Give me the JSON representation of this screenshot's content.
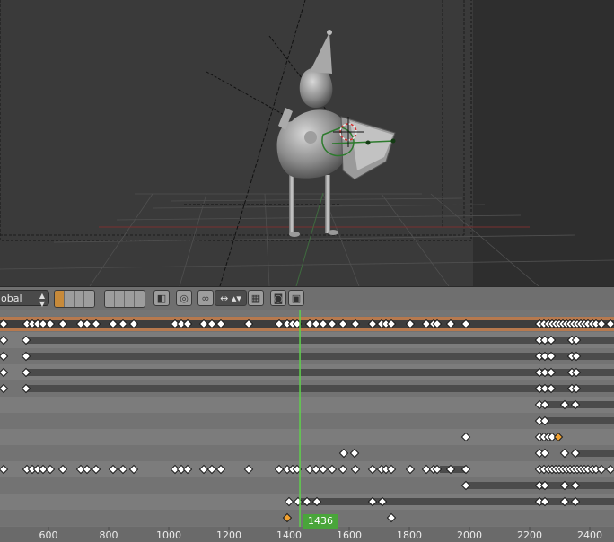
{
  "viewport": {
    "label": "3D Viewport"
  },
  "header": {
    "transform_orientation": "obal",
    "select_arrows": "▲▼"
  },
  "timeline": {
    "current_frame": "1436",
    "current_frame_value": 1436,
    "ruler_labels": [
      "600",
      "800",
      "1000",
      "1200",
      "1400",
      "1600",
      "1800",
      "2000",
      "2200",
      "2400"
    ],
    "ruler_values": [
      600,
      800,
      1000,
      1200,
      1400,
      1600,
      1800,
      2000,
      2200,
      2400
    ]
  },
  "colors": {
    "accent_current_frame": "#49a53a",
    "summary_row": "#b7794e",
    "selected_key": "#f0a030",
    "keyframe": "#ffffff"
  },
  "icons": [
    "filter-icon",
    "ghost-icon",
    "link-icon",
    "snap-icon",
    "camera-icon",
    "clapper-icon"
  ]
}
